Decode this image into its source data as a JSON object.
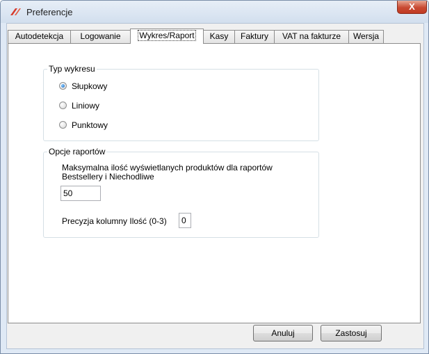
{
  "window": {
    "title": "Preferencje",
    "close_label": "X"
  },
  "tabs": [
    {
      "label": "Autodetekcja",
      "active": false
    },
    {
      "label": "Logowanie",
      "active": false
    },
    {
      "label": "Wykres/Raport",
      "active": true
    },
    {
      "label": "Kasy",
      "active": false
    },
    {
      "label": "Faktury",
      "active": false
    },
    {
      "label": "VAT na fakturze",
      "active": false
    },
    {
      "label": "Wersja",
      "active": false
    }
  ],
  "chart_type_group": {
    "title": "Typ wykresu",
    "options": [
      {
        "label": "Słupkowy",
        "selected": true
      },
      {
        "label": "Liniowy",
        "selected": false
      },
      {
        "label": "Punktowy",
        "selected": false
      }
    ]
  },
  "report_options_group": {
    "title": "Opcje raportów",
    "max_products_label": "Maksymalna ilość wyświetlanych produktów dla raportów Bestsellery i Niechodliwe",
    "max_products_value": "50",
    "precision_label": "Precyzja kolumny Ilość (0-3)",
    "precision_value": "0"
  },
  "buttons": {
    "cancel_label": "Anuluj",
    "apply_label": "Zastosuj"
  }
}
